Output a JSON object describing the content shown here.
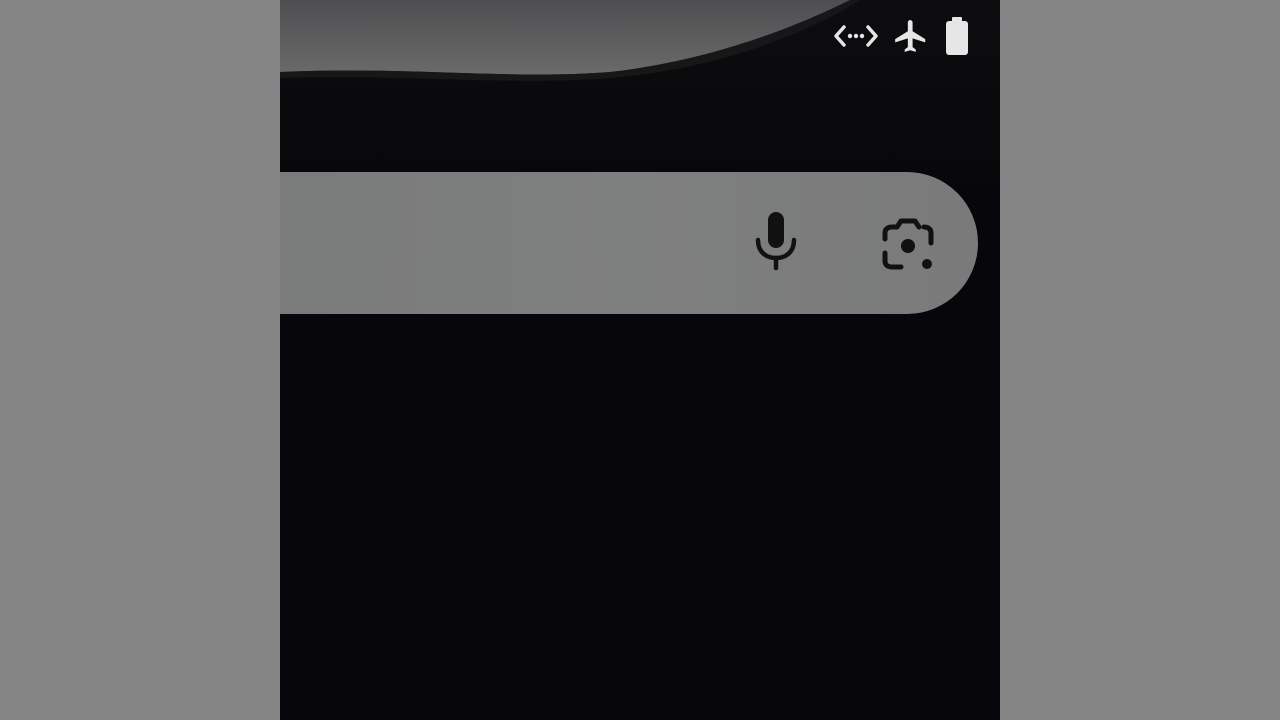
{
  "colors": {
    "backdrop": "#858585",
    "screen_background": "#07070b",
    "search_bar": "#7d7e7e",
    "status_icons": "#e6e6e6",
    "search_icons": "#111111"
  },
  "status_bar": {
    "icons": [
      "data-saver-icon",
      "airplane-mode-icon",
      "battery-icon"
    ]
  },
  "search_bar": {
    "placeholder": "",
    "value": "",
    "icons": [
      "microphone-icon",
      "google-lens-icon"
    ]
  }
}
